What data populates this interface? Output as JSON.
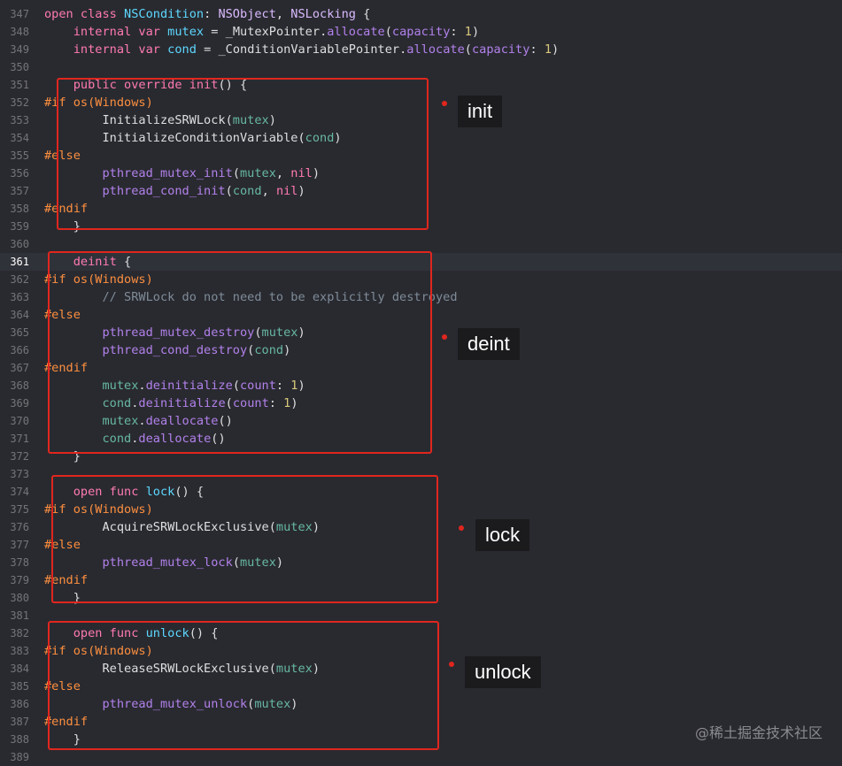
{
  "editor": {
    "current_line": "361",
    "lines": [
      {
        "n": "347",
        "t": [
          [
            "kw",
            "open "
          ],
          [
            "kw",
            "class "
          ],
          [
            "tyd",
            "NSCondition"
          ],
          [
            "plain",
            ": "
          ],
          [
            "ty",
            "NSObject"
          ],
          [
            "plain",
            ", "
          ],
          [
            "ty",
            "NSLocking"
          ],
          [
            "plain",
            " {"
          ]
        ]
      },
      {
        "n": "348",
        "t": [
          [
            "plain",
            "    "
          ],
          [
            "kw",
            "internal "
          ],
          [
            "kw",
            "var "
          ],
          [
            "tyd",
            "mutex"
          ],
          [
            "plain",
            " = "
          ],
          [
            "plain",
            "_MutexPointer"
          ],
          [
            "plain",
            "."
          ],
          [
            "call",
            "allocate"
          ],
          [
            "plain",
            "("
          ],
          [
            "call",
            "capacity"
          ],
          [
            "plain",
            ": "
          ],
          [
            "num",
            "1"
          ],
          [
            "plain",
            ")"
          ]
        ]
      },
      {
        "n": "349",
        "t": [
          [
            "plain",
            "    "
          ],
          [
            "kw",
            "internal "
          ],
          [
            "kw",
            "var "
          ],
          [
            "tyd",
            "cond"
          ],
          [
            "plain",
            " = "
          ],
          [
            "plain",
            "_ConditionVariablePointer"
          ],
          [
            "plain",
            "."
          ],
          [
            "call",
            "allocate"
          ],
          [
            "plain",
            "("
          ],
          [
            "call",
            "capacity"
          ],
          [
            "plain",
            ": "
          ],
          [
            "num",
            "1"
          ],
          [
            "plain",
            ")"
          ]
        ]
      },
      {
        "n": "350",
        "t": []
      },
      {
        "n": "351",
        "t": [
          [
            "plain",
            "    "
          ],
          [
            "kw",
            "public "
          ],
          [
            "kw",
            "override "
          ],
          [
            "kw",
            "init"
          ],
          [
            "plain",
            "() {"
          ]
        ]
      },
      {
        "n": "352",
        "t": [
          [
            "pre",
            "#if "
          ],
          [
            "pre",
            "os(Windows)"
          ]
        ]
      },
      {
        "n": "353",
        "t": [
          [
            "plain",
            "        InitializeSRWLock("
          ],
          [
            "fn",
            "mutex"
          ],
          [
            "plain",
            ")"
          ]
        ]
      },
      {
        "n": "354",
        "t": [
          [
            "plain",
            "        InitializeConditionVariable("
          ],
          [
            "fn",
            "cond"
          ],
          [
            "plain",
            ")"
          ]
        ]
      },
      {
        "n": "355",
        "t": [
          [
            "pre",
            "#else"
          ]
        ]
      },
      {
        "n": "356",
        "t": [
          [
            "plain",
            "        "
          ],
          [
            "call",
            "pthread_mutex_init"
          ],
          [
            "plain",
            "("
          ],
          [
            "fn",
            "mutex"
          ],
          [
            "plain",
            ", "
          ],
          [
            "kw",
            "nil"
          ],
          [
            "plain",
            ")"
          ]
        ]
      },
      {
        "n": "357",
        "t": [
          [
            "plain",
            "        "
          ],
          [
            "call",
            "pthread_cond_init"
          ],
          [
            "plain",
            "("
          ],
          [
            "fn",
            "cond"
          ],
          [
            "plain",
            ", "
          ],
          [
            "kw",
            "nil"
          ],
          [
            "plain",
            ")"
          ]
        ]
      },
      {
        "n": "358",
        "t": [
          [
            "pre",
            "#endif"
          ]
        ]
      },
      {
        "n": "359",
        "t": [
          [
            "plain",
            "    }"
          ]
        ]
      },
      {
        "n": "360",
        "t": []
      },
      {
        "n": "361",
        "t": [
          [
            "plain",
            "    "
          ],
          [
            "kw",
            "deinit"
          ],
          [
            "plain",
            " {"
          ]
        ]
      },
      {
        "n": "362",
        "t": [
          [
            "pre",
            "#if "
          ],
          [
            "pre",
            "os(Windows)"
          ]
        ]
      },
      {
        "n": "363",
        "t": [
          [
            "plain",
            "        "
          ],
          [
            "cmt",
            "// SRWLock do not need to be explicitly destroyed"
          ]
        ]
      },
      {
        "n": "364",
        "t": [
          [
            "pre",
            "#else"
          ]
        ]
      },
      {
        "n": "365",
        "t": [
          [
            "plain",
            "        "
          ],
          [
            "call",
            "pthread_mutex_destroy"
          ],
          [
            "plain",
            "("
          ],
          [
            "fn",
            "mutex"
          ],
          [
            "plain",
            ")"
          ]
        ]
      },
      {
        "n": "366",
        "t": [
          [
            "plain",
            "        "
          ],
          [
            "call",
            "pthread_cond_destroy"
          ],
          [
            "plain",
            "("
          ],
          [
            "fn",
            "cond"
          ],
          [
            "plain",
            ")"
          ]
        ]
      },
      {
        "n": "367",
        "t": [
          [
            "pre",
            "#endif"
          ]
        ]
      },
      {
        "n": "368",
        "t": [
          [
            "plain",
            "        "
          ],
          [
            "fn",
            "mutex"
          ],
          [
            "plain",
            "."
          ],
          [
            "call",
            "deinitialize"
          ],
          [
            "plain",
            "("
          ],
          [
            "call",
            "count"
          ],
          [
            "plain",
            ": "
          ],
          [
            "num",
            "1"
          ],
          [
            "plain",
            ")"
          ]
        ]
      },
      {
        "n": "369",
        "t": [
          [
            "plain",
            "        "
          ],
          [
            "fn",
            "cond"
          ],
          [
            "plain",
            "."
          ],
          [
            "call",
            "deinitialize"
          ],
          [
            "plain",
            "("
          ],
          [
            "call",
            "count"
          ],
          [
            "plain",
            ": "
          ],
          [
            "num",
            "1"
          ],
          [
            "plain",
            ")"
          ]
        ]
      },
      {
        "n": "370",
        "t": [
          [
            "plain",
            "        "
          ],
          [
            "fn",
            "mutex"
          ],
          [
            "plain",
            "."
          ],
          [
            "call",
            "deallocate"
          ],
          [
            "plain",
            "()"
          ]
        ]
      },
      {
        "n": "371",
        "t": [
          [
            "plain",
            "        "
          ],
          [
            "fn",
            "cond"
          ],
          [
            "plain",
            "."
          ],
          [
            "call",
            "deallocate"
          ],
          [
            "plain",
            "()"
          ]
        ]
      },
      {
        "n": "372",
        "t": [
          [
            "plain",
            "    }"
          ]
        ]
      },
      {
        "n": "373",
        "t": []
      },
      {
        "n": "374",
        "t": [
          [
            "plain",
            "    "
          ],
          [
            "kw",
            "open "
          ],
          [
            "kw",
            "func "
          ],
          [
            "tyd",
            "lock"
          ],
          [
            "plain",
            "() {"
          ]
        ]
      },
      {
        "n": "375",
        "t": [
          [
            "pre",
            "#if "
          ],
          [
            "pre",
            "os(Windows)"
          ]
        ]
      },
      {
        "n": "376",
        "t": [
          [
            "plain",
            "        AcquireSRWLockExclusive("
          ],
          [
            "fn",
            "mutex"
          ],
          [
            "plain",
            ")"
          ]
        ]
      },
      {
        "n": "377",
        "t": [
          [
            "pre",
            "#else"
          ]
        ]
      },
      {
        "n": "378",
        "t": [
          [
            "plain",
            "        "
          ],
          [
            "call",
            "pthread_mutex_lock"
          ],
          [
            "plain",
            "("
          ],
          [
            "fn",
            "mutex"
          ],
          [
            "plain",
            ")"
          ]
        ]
      },
      {
        "n": "379",
        "t": [
          [
            "pre",
            "#endif"
          ]
        ]
      },
      {
        "n": "380",
        "t": [
          [
            "plain",
            "    }"
          ]
        ]
      },
      {
        "n": "381",
        "t": []
      },
      {
        "n": "382",
        "t": [
          [
            "plain",
            "    "
          ],
          [
            "kw",
            "open "
          ],
          [
            "kw",
            "func "
          ],
          [
            "tyd",
            "unlock"
          ],
          [
            "plain",
            "() {"
          ]
        ]
      },
      {
        "n": "383",
        "t": [
          [
            "pre",
            "#if "
          ],
          [
            "pre",
            "os(Windows)"
          ]
        ]
      },
      {
        "n": "384",
        "t": [
          [
            "plain",
            "        ReleaseSRWLockExclusive("
          ],
          [
            "fn",
            "mutex"
          ],
          [
            "plain",
            ")"
          ]
        ]
      },
      {
        "n": "385",
        "t": [
          [
            "pre",
            "#else"
          ]
        ]
      },
      {
        "n": "386",
        "t": [
          [
            "plain",
            "        "
          ],
          [
            "call",
            "pthread_mutex_unlock"
          ],
          [
            "plain",
            "("
          ],
          [
            "fn",
            "mutex"
          ],
          [
            "plain",
            ")"
          ]
        ]
      },
      {
        "n": "387",
        "t": [
          [
            "pre",
            "#endif"
          ]
        ]
      },
      {
        "n": "388",
        "t": [
          [
            "plain",
            "    }"
          ]
        ]
      },
      {
        "n": "389",
        "t": []
      }
    ]
  },
  "annotations": [
    {
      "id": "init",
      "label": "init"
    },
    {
      "id": "deinit",
      "label": "deint"
    },
    {
      "id": "lock",
      "label": "lock"
    },
    {
      "id": "unlock",
      "label": "unlock"
    }
  ],
  "watermark": "@稀土掘金技术社区",
  "colors": {
    "background": "#292a30",
    "keyword": "#ff7ab2",
    "type": "#dabaff",
    "declaration": "#5dd8ff",
    "variable": "#67b7a4",
    "call": "#b281eb",
    "number": "#d9c97c",
    "preprocessor": "#fd8f3f",
    "comment": "#7f8c98",
    "annotation_red": "#e0261e"
  }
}
